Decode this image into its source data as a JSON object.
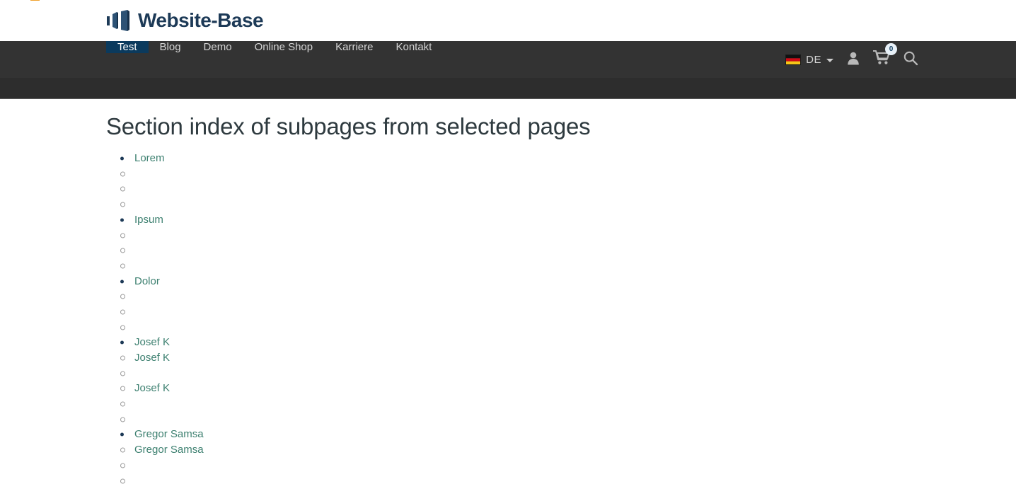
{
  "brand": {
    "name": "Website-Base",
    "logo_mark_name": "website-base-logo-mark",
    "mark_color": "#1d3a57",
    "accent_color": "#f0a22e"
  },
  "nav": {
    "items": [
      {
        "label": "Test",
        "active": true
      },
      {
        "label": "Blog",
        "active": false
      },
      {
        "label": "Demo",
        "active": false
      },
      {
        "label": "Online Shop",
        "active": false
      },
      {
        "label": "Karriere",
        "active": false
      },
      {
        "label": "Kontakt",
        "active": false
      }
    ],
    "active_bg": "#0b3a5d",
    "bar_bg": "#333333"
  },
  "toolbar": {
    "language": {
      "code": "DE",
      "flag_icon": "german-flag-icon",
      "caret_icon": "chevron-down-icon"
    },
    "account_icon": "user-icon",
    "cart_icon": "shopping-cart-icon",
    "cart_count": "0",
    "search_icon": "search-icon"
  },
  "main": {
    "title": "Section index of subpages from selected pages",
    "list": [
      {
        "marker": "disc",
        "label": "Lorem"
      },
      {
        "marker": "circle",
        "label": ""
      },
      {
        "marker": "circle",
        "label": ""
      },
      {
        "marker": "circle",
        "label": ""
      },
      {
        "marker": "disc",
        "label": "Ipsum"
      },
      {
        "marker": "circle",
        "label": ""
      },
      {
        "marker": "circle",
        "label": ""
      },
      {
        "marker": "circle",
        "label": ""
      },
      {
        "marker": "disc",
        "label": "Dolor"
      },
      {
        "marker": "circle",
        "label": ""
      },
      {
        "marker": "circle",
        "label": ""
      },
      {
        "marker": "circle",
        "label": ""
      },
      {
        "marker": "disc",
        "label": "Josef K"
      },
      {
        "marker": "circle",
        "label": "Josef K"
      },
      {
        "marker": "circle",
        "label": ""
      },
      {
        "marker": "circle",
        "label": "Josef K"
      },
      {
        "marker": "circle",
        "label": ""
      },
      {
        "marker": "circle",
        "label": ""
      },
      {
        "marker": "disc",
        "label": "Gregor Samsa"
      },
      {
        "marker": "circle",
        "label": "Gregor Samsa"
      },
      {
        "marker": "circle",
        "label": ""
      },
      {
        "marker": "circle",
        "label": ""
      }
    ],
    "link_color": "#3d8070"
  }
}
